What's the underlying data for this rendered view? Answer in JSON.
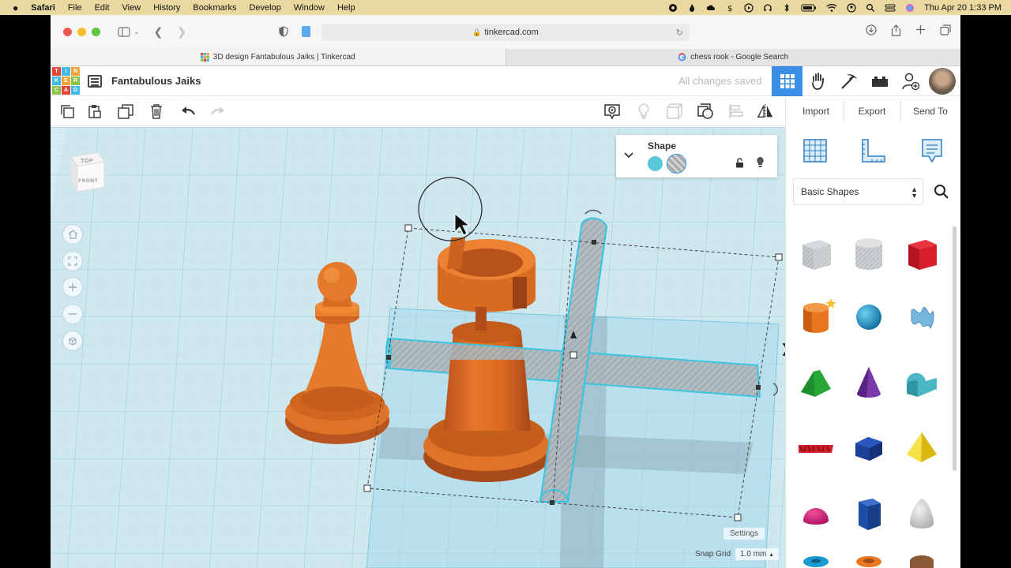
{
  "menubar": {
    "app_name": "Safari",
    "items": [
      "File",
      "Edit",
      "View",
      "History",
      "Bookmarks",
      "Develop",
      "Window",
      "Help"
    ],
    "clock": "Thu Apr 20  1:33 PM"
  },
  "browser": {
    "url": "tinkercad.com",
    "tabs": [
      {
        "title": "3D design Fantabulous Jaiks | Tinkercad",
        "active": true
      },
      {
        "title": "chess rook - Google Search",
        "active": false
      }
    ]
  },
  "app": {
    "logo_letters": [
      "T",
      "I",
      "N",
      "K",
      "E",
      "R",
      "C",
      "A",
      "D"
    ],
    "logo_colors": [
      "#e2453a",
      "#3eb9e8",
      "#f1a33c",
      "#3eb9e8",
      "#f1a33c",
      "#8bc34a",
      "#8bc34a",
      "#e2453a",
      "#3eb9e8"
    ],
    "design_name": "Fantabulous Jaiks",
    "save_status": "All changes saved",
    "accent_color": "#3a8ee6"
  },
  "edit_toolbar": {
    "left_icons": [
      "copy-icon",
      "paste-icon",
      "duplicate-icon",
      "delete-icon",
      "undo-icon",
      "redo-icon"
    ],
    "right_icons": [
      "notes-icon",
      "show-all-icon",
      "hole-icon",
      "group-icon",
      "align-icon",
      "mirror-icon"
    ]
  },
  "right_panel": {
    "buttons": [
      "Import",
      "Export",
      "Send To"
    ],
    "library_tabs": [
      "workplane-icon",
      "ruler-icon",
      "notes-icon"
    ],
    "category": "Basic Shapes",
    "shapes": [
      {
        "name": "box-hole",
        "color": "#b5b9bd"
      },
      {
        "name": "cylinder-hole",
        "color": "#c6c9cc"
      },
      {
        "name": "box",
        "color": "#d81e2a"
      },
      {
        "name": "cylinder",
        "color": "#e8771f"
      },
      {
        "name": "sphere",
        "color": "#1a9bd0"
      },
      {
        "name": "scribble",
        "color": "#78b6e0"
      },
      {
        "name": "roof",
        "color": "#29a838"
      },
      {
        "name": "cone",
        "color": "#7a3aa8"
      },
      {
        "name": "round-roof",
        "color": "#4bb7c4"
      },
      {
        "name": "text",
        "color": "#cc1f2a"
      },
      {
        "name": "polygon-prism",
        "color": "#1d3f96"
      },
      {
        "name": "pyramid",
        "color": "#f2d31e"
      },
      {
        "name": "half-sphere",
        "color": "#d6187a"
      },
      {
        "name": "polygon",
        "color": "#1b4fa8"
      },
      {
        "name": "paraboloid",
        "color": "#c9c9c9"
      }
    ]
  },
  "workplane": {
    "view_cube": {
      "top": "TOP",
      "front": "FRONT"
    },
    "shape_panel": {
      "title": "Shape",
      "solid_color": "#5ac8d8"
    },
    "settings_label": "Settings",
    "snap_label": "Snap Grid",
    "snap_value": "1.0 mm"
  }
}
